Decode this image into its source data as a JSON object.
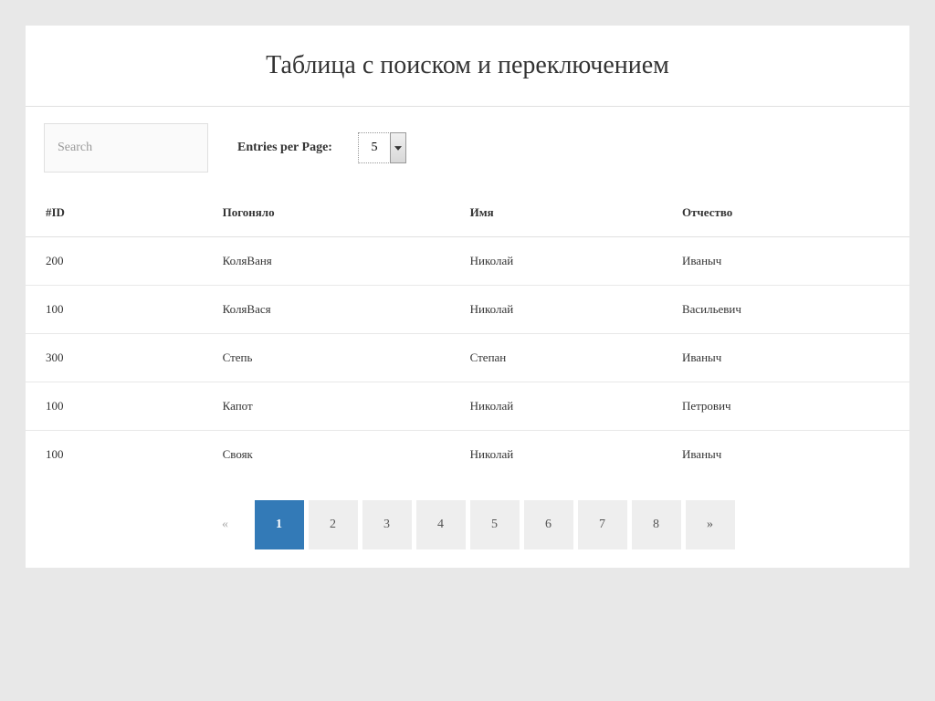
{
  "title": "Таблица с поиском и переключением",
  "controls": {
    "search_placeholder": "Search",
    "entries_label": "Entries per Page:",
    "entries_value": "5"
  },
  "table": {
    "headers": {
      "id": "#ID",
      "nickname": "Погоняло",
      "name": "Имя",
      "patronymic": "Отчество"
    },
    "rows": [
      {
        "id": "200",
        "nickname": "КоляВаня",
        "name": "Николай",
        "patronymic": "Иваныч"
      },
      {
        "id": "100",
        "nickname": "КоляВася",
        "name": "Николай",
        "patronymic": "Васильевич"
      },
      {
        "id": "300",
        "nickname": "Степь",
        "name": "Степан",
        "patronymic": "Иваныч"
      },
      {
        "id": "100",
        "nickname": "Капот",
        "name": "Николай",
        "patronymic": "Петрович"
      },
      {
        "id": "100",
        "nickname": "Свояк",
        "name": "Николай",
        "patronymic": "Иваныч"
      }
    ]
  },
  "pagination": {
    "prev": "«",
    "next": "»",
    "pages": [
      "1",
      "2",
      "3",
      "4",
      "5",
      "6",
      "7",
      "8"
    ],
    "active_index": 0
  }
}
